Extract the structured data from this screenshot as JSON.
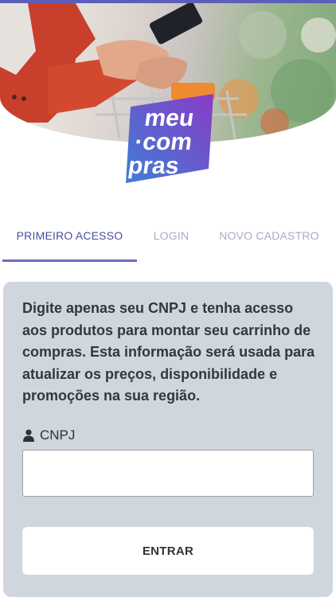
{
  "brand": {
    "logo_lines": [
      "meu",
      "com",
      "pras"
    ]
  },
  "tabs": [
    {
      "label": "PRIMEIRO ACESSO",
      "active": true
    },
    {
      "label": "LOGIN",
      "active": false
    },
    {
      "label": "NOVO CADASTRO",
      "active": false
    }
  ],
  "form": {
    "description": "Digite apenas seu CNPJ e tenha acesso aos produtos para montar seu carrinho de compras. Esta informação será usada para atualizar os preços, disponibilidade e promoções na sua região.",
    "cnpj_label": "CNPJ",
    "cnpj_value": "",
    "submit_label": "ENTRAR"
  },
  "colors": {
    "accent": "#5b5fb8",
    "logo_gradient": [
      "#3d7fd6",
      "#8a3bc5"
    ],
    "card_bg": "#cfd6dd"
  },
  "icons": {
    "cnpj": "user-icon"
  }
}
